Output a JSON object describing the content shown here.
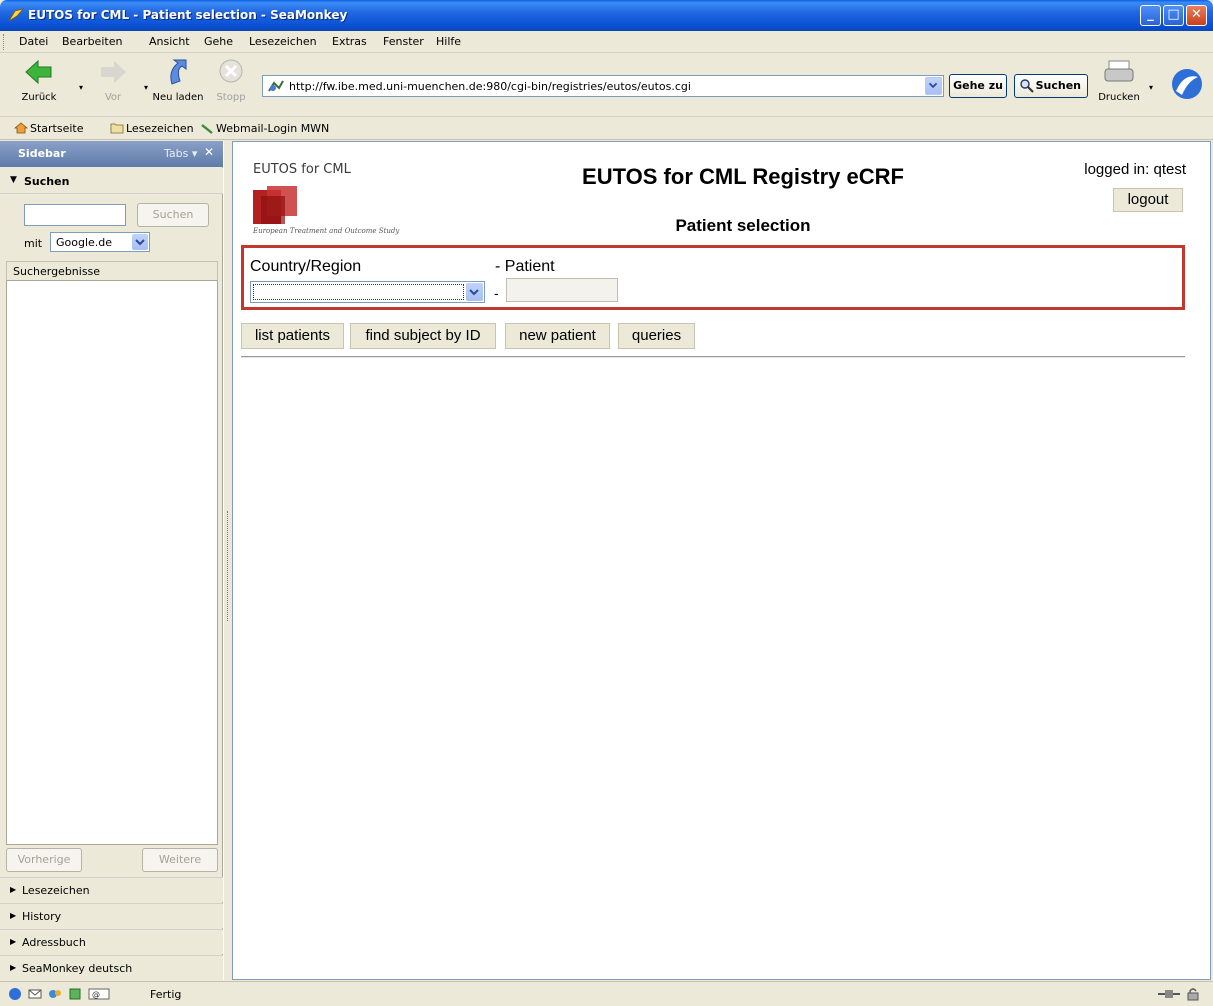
{
  "window": {
    "title": "EUTOS for CML - Patient selection - SeaMonkey"
  },
  "menu": {
    "items": [
      "Datei",
      "Bearbeiten",
      "Ansicht",
      "Gehe",
      "Lesezeichen",
      "Extras",
      "Fenster",
      "Hilfe"
    ]
  },
  "nav": {
    "back_label": "Zurück",
    "forward_label": "Vor",
    "reload_label": "Neu laden",
    "stop_label": "Stopp",
    "url": "http://fw.ibe.med.uni-muenchen.de:980/cgi-bin/registries/eutos/eutos.cgi",
    "go_label": "Gehe zu",
    "search_label": "Suchen",
    "print_label": "Drucken"
  },
  "personal_toolbar": {
    "items": [
      "Startseite",
      "Lesezeichen",
      "Webmail-Login MWN"
    ]
  },
  "sidebar": {
    "title": "Sidebar",
    "tabs_label": "Tabs",
    "search_panel_title": "Suchen",
    "search_input_value": "",
    "search_button": "Suchen",
    "engine_prefix": "mit",
    "engine_value": "Google.de",
    "results_label": "Suchergebnisse",
    "prev_button": "Vorherige",
    "next_button": "Weitere",
    "panels": [
      "Lesezeichen",
      "History",
      "Adressbuch",
      "SeaMonkey deutsch"
    ]
  },
  "page": {
    "logo_title": "EUTOS for CML",
    "logo_subtitle": "European Treatment and Outcome Study",
    "title": "EUTOS for CML Registry eCRF",
    "subtitle": "Patient selection",
    "logged_in": "logged in: qtest",
    "logout": "logout",
    "country_label": "Country/Region",
    "patient_label": "- Patient",
    "dash": "-",
    "country_value": "",
    "patient_value": "",
    "actions": [
      "list patients",
      "find subject by ID",
      "new patient",
      "queries"
    ]
  },
  "status": {
    "text": "Fertig"
  },
  "colors": {
    "accent": "#c0392b",
    "titlebar": "#0a5ee8",
    "logo_red": "#b22222"
  }
}
